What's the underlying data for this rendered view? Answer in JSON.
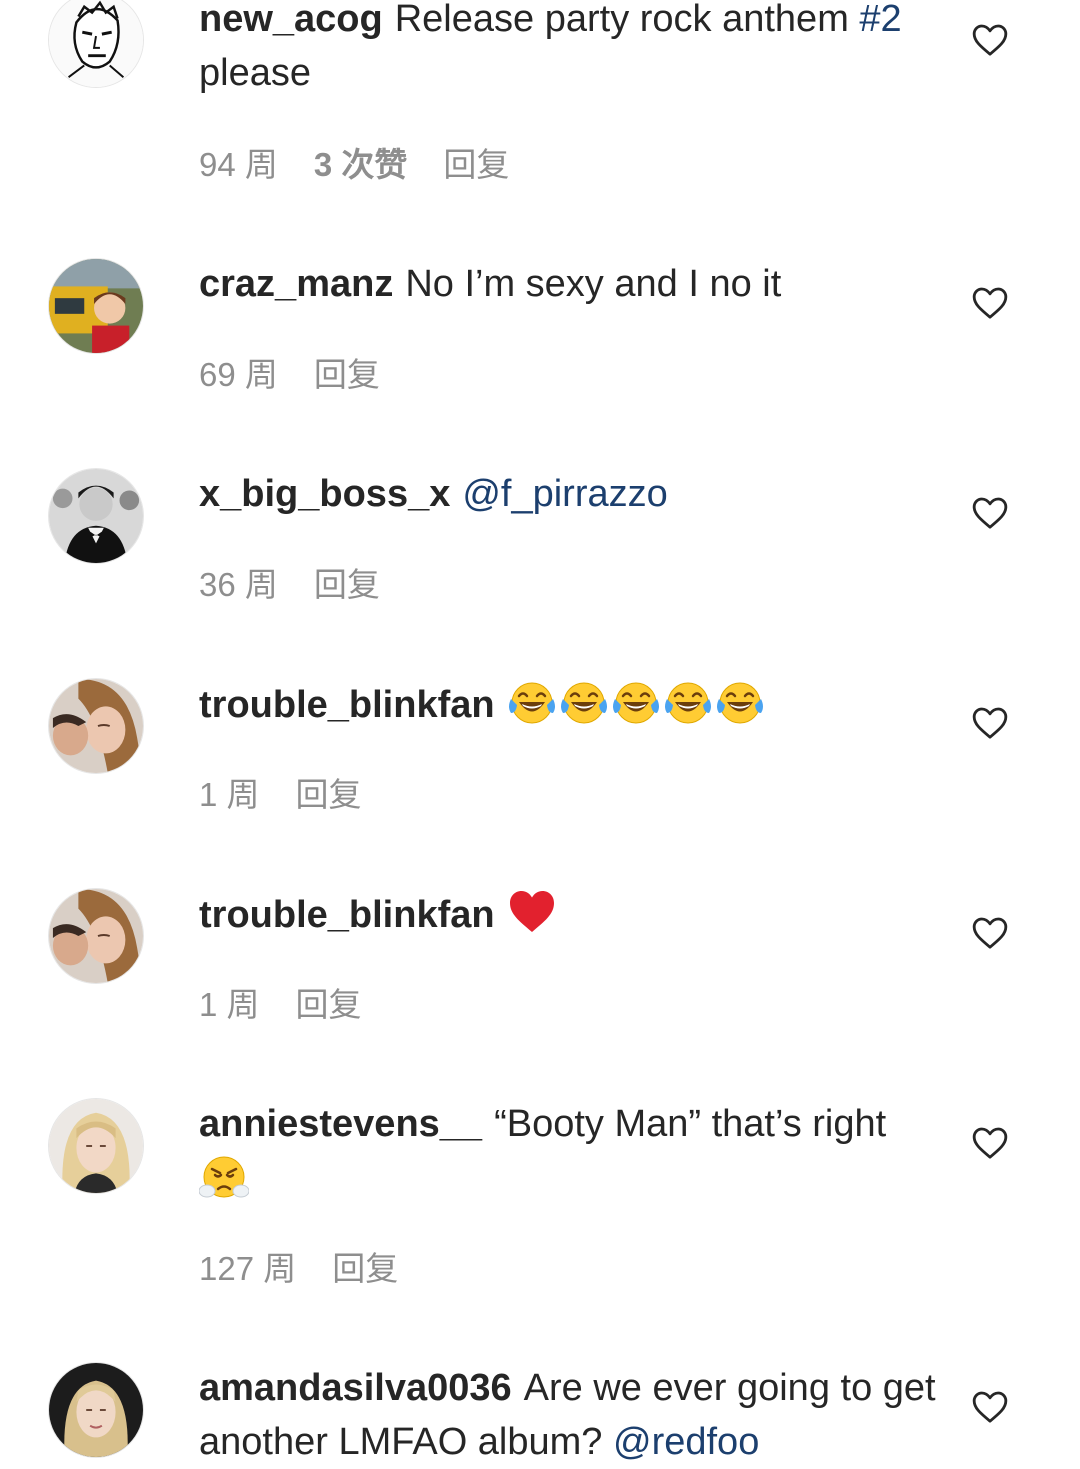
{
  "comments": [
    {
      "username": "new_acog",
      "text_before": "Release party rock anthem ",
      "hashtag": "#2",
      "text_after": " please",
      "age": "94 周",
      "likes": "3 次赞",
      "reply": "回复"
    },
    {
      "username": "craz_manz",
      "text": "No I’m sexy and I no it",
      "age": "69 周",
      "reply": "回复"
    },
    {
      "username": "x_big_boss_x",
      "mention": "@f_pirrazzo",
      "age": "36 周",
      "reply": "回复"
    },
    {
      "username": "trouble_blinkfan",
      "emoji": "tears-of-joy-emoji x5",
      "age": "1 周",
      "reply": "回复"
    },
    {
      "username": "trouble_blinkfan",
      "emoji": "red-heart-emoji",
      "age": "1 周",
      "reply": "回复"
    },
    {
      "username": "anniestevens__",
      "text_before": "“Booty Man” that’s right ",
      "emoji": "steam-from-nose-emoji",
      "age": "127 周",
      "reply": "回复"
    },
    {
      "username": "amandasilva0036",
      "text": "Are we ever going to get another LMFAO album? ",
      "mention": "@redfoo"
    }
  ],
  "colors": {
    "text": "#262626",
    "meta": "#8e8e8e",
    "link": "#1c3f6e"
  }
}
